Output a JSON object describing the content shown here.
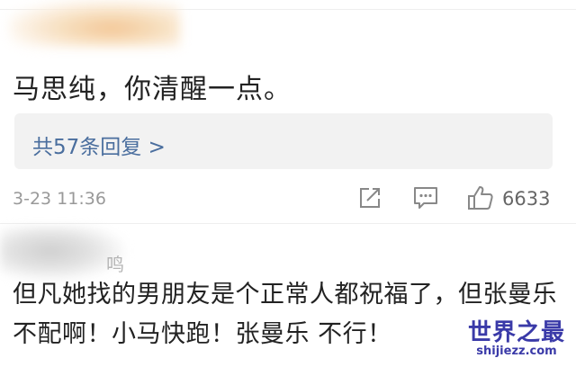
{
  "comment1": {
    "text": "马思纯，你清醒一点。",
    "replies_link": "共57条回复 >",
    "timestamp": "3-23 11:36",
    "like_count": "6633"
  },
  "comment2": {
    "username_visible": "鸣",
    "text": "但凡她找的男朋友是个正常人都祝福了，但张曼乐不配啊！小马快跑！张曼乐 不行！"
  },
  "watermark": {
    "title": "世界之最",
    "url": "shijiezz.com"
  },
  "icons": [
    "share-icon",
    "comment-icon",
    "like-icon"
  ],
  "colors": {
    "link": "#4a6e9e",
    "watermark": "#3a3aa8",
    "muted": "#999999"
  }
}
